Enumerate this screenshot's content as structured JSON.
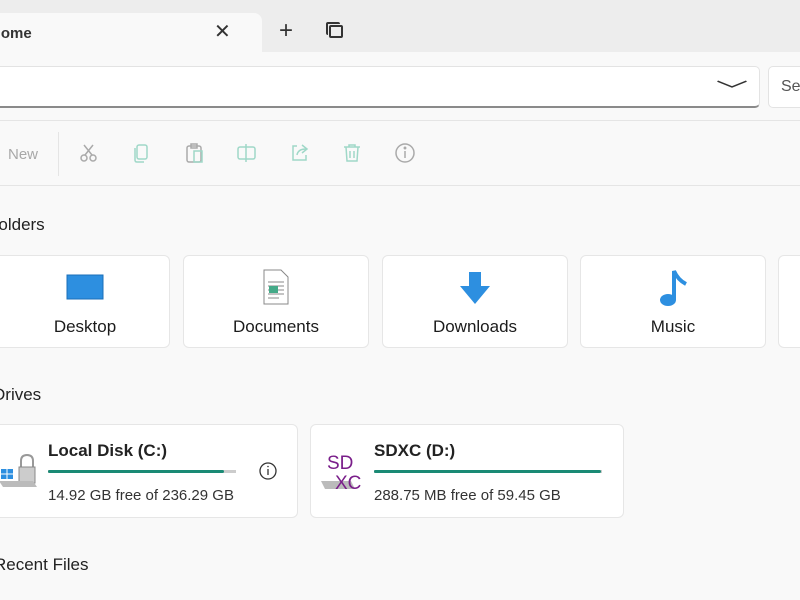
{
  "tab": {
    "title": "Home",
    "close": "✕"
  },
  "tab_actions": {
    "new_tab": "+"
  },
  "address": {
    "value": "",
    "chevron": "﹀"
  },
  "search": {
    "placeholder": "Se"
  },
  "toolbar": {
    "new_label": "New",
    "icons": [
      "cut-icon",
      "copy-icon",
      "paste-icon",
      "rename-icon",
      "share-icon",
      "delete-icon",
      "properties-icon"
    ]
  },
  "sections": {
    "folders": "Folders",
    "drives": "Drives",
    "recent": "Recent Files"
  },
  "folders": [
    {
      "label": "Desktop"
    },
    {
      "label": "Documents"
    },
    {
      "label": "Downloads"
    },
    {
      "label": "Music"
    }
  ],
  "drives": [
    {
      "name": "Local Disk (C:)",
      "free": "14.92 GB free of 236.29 GB",
      "used_percent": 93.7
    },
    {
      "name": "SDXC (D:)",
      "free": "288.75 MB free of 59.45 GB",
      "used_percent": 99.5,
      "icon_text": "SD XC"
    }
  ],
  "colors": {
    "accent": "#1a8a75",
    "folder_blue": "#2d8fe0"
  }
}
